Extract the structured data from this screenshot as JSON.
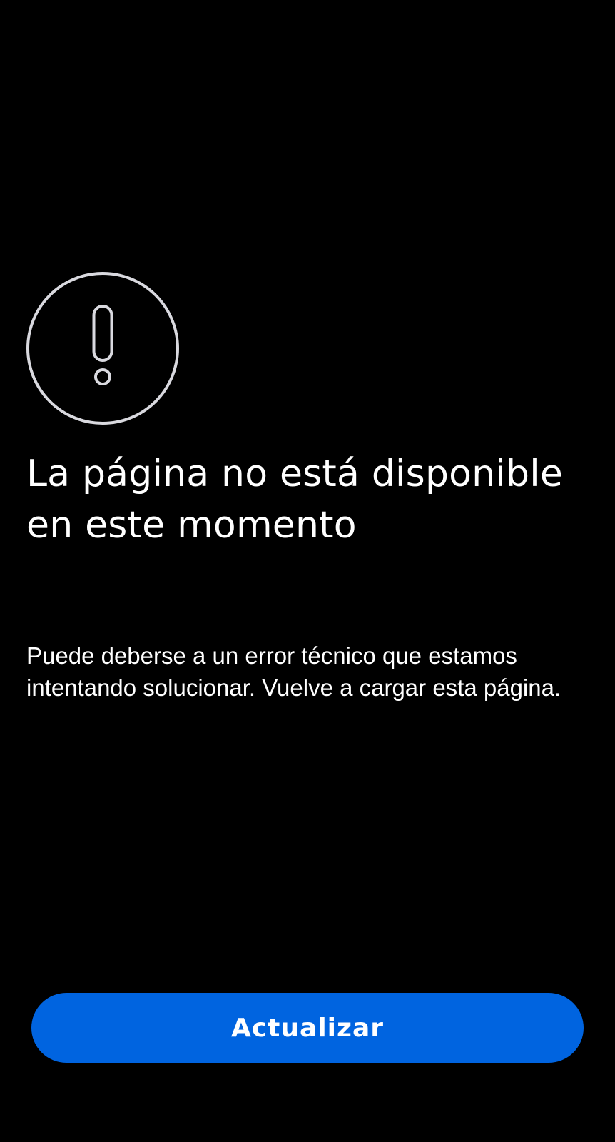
{
  "error_page": {
    "icon": "exclamation-circle-icon",
    "title": "La página no está disponible en este momento",
    "description": "Puede deberse a un error técnico que estamos intentando solucionar. Vuelve a cargar esta página.",
    "refresh_button_label": "Actualizar"
  },
  "colors": {
    "background": "#000000",
    "text": "#ffffff",
    "icon_stroke": "#d9d9df",
    "button": "#0064e0"
  }
}
